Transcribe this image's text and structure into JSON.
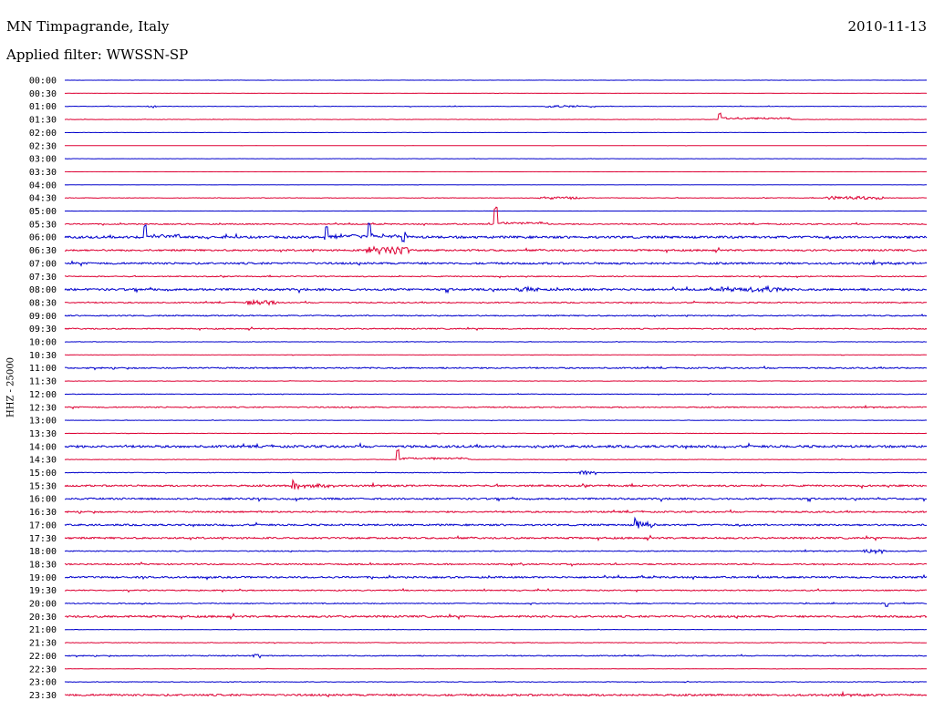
{
  "header": {
    "station": "MN Timpagrande, Italy",
    "date": "2010-11-13",
    "filter": "Applied filter: WWSSN-SP"
  },
  "axis": {
    "ylabel": "HHZ - 25000"
  },
  "colors": {
    "even_row": "#0000cc",
    "odd_row": "#dd0033"
  },
  "chart_data": {
    "type": "line",
    "title": "MN Timpagrande, Italy",
    "subtitle": "Applied filter: WWSSN-SP",
    "ylabel": "HHZ - 25000",
    "xlabel": "",
    "grid": false,
    "x_unit": "minutes past row start",
    "x_range": [
      0,
      30
    ],
    "row_labels": [
      "00:00",
      "00:30",
      "01:00",
      "01:30",
      "02:00",
      "02:30",
      "03:00",
      "03:30",
      "04:00",
      "04:30",
      "05:00",
      "05:30",
      "06:00",
      "06:30",
      "07:00",
      "07:30",
      "08:00",
      "08:30",
      "09:00",
      "09:30",
      "10:00",
      "10:30",
      "11:00",
      "11:30",
      "12:00",
      "12:30",
      "13:00",
      "13:30",
      "14:00",
      "14:30",
      "15:00",
      "15:30",
      "16:00",
      "16:30",
      "17:00",
      "17:30",
      "18:00",
      "18:30",
      "19:00",
      "19:30",
      "20:00",
      "20:30",
      "21:00",
      "21:30",
      "22:00",
      "22:30",
      "23:00",
      "23:30"
    ],
    "row_noise": [
      0.1,
      0.1,
      0.25,
      0.2,
      0.1,
      0.1,
      0.15,
      0.1,
      0.1,
      0.3,
      0.1,
      0.6,
      1.2,
      0.9,
      1.0,
      0.5,
      1.1,
      0.6,
      0.6,
      0.6,
      0.2,
      0.2,
      0.7,
      0.2,
      0.3,
      0.6,
      0.2,
      0.2,
      1.2,
      0.3,
      0.3,
      0.9,
      0.9,
      0.8,
      0.9,
      0.9,
      0.5,
      0.7,
      0.9,
      0.6,
      0.5,
      1.0,
      0.2,
      0.3,
      0.5,
      0.2,
      0.3,
      1.0
    ],
    "events": [
      {
        "row": "01:00",
        "minute": 2.8,
        "amplitude": 1.5,
        "duration": 0.4,
        "kind": "burst"
      },
      {
        "row": "01:00",
        "minute": 16.7,
        "amplitude": 1.0,
        "duration": 1.8,
        "kind": "burst"
      },
      {
        "row": "01:30",
        "minute": 22.8,
        "amplitude": 6,
        "duration": 2.5,
        "kind": "offset"
      },
      {
        "row": "04:30",
        "minute": 16.5,
        "amplitude": 1.2,
        "duration": 1.5,
        "kind": "burst"
      },
      {
        "row": "04:30",
        "minute": 26.5,
        "amplitude": 1.5,
        "duration": 2.0,
        "kind": "burst"
      },
      {
        "row": "05:30",
        "minute": 15.0,
        "amplitude": 17,
        "duration": 1.8,
        "kind": "offset"
      },
      {
        "row": "06:00",
        "minute": 2.8,
        "amplitude": 12,
        "duration": 1.2,
        "kind": "offset"
      },
      {
        "row": "06:00",
        "minute": 9.1,
        "amplitude": 10,
        "duration": 1.6,
        "kind": "offset"
      },
      {
        "row": "06:00",
        "minute": 10.6,
        "amplitude": 13,
        "duration": 1.4,
        "kind": "offset"
      },
      {
        "row": "06:00",
        "minute": 11.8,
        "amplitude": 5,
        "duration": 0.3,
        "kind": "spike"
      },
      {
        "row": "06:30",
        "minute": 10.5,
        "amplitude": 4,
        "duration": 1.5,
        "kind": "burst"
      },
      {
        "row": "08:00",
        "minute": 15.8,
        "amplitude": 2,
        "duration": 0.8,
        "kind": "burst"
      },
      {
        "row": "08:00",
        "minute": 22.8,
        "amplitude": 2.5,
        "duration": 2.4,
        "kind": "burst"
      },
      {
        "row": "08:30",
        "minute": 6.3,
        "amplitude": 2,
        "duration": 1.2,
        "kind": "burst"
      },
      {
        "row": "14:30",
        "minute": 11.6,
        "amplitude": 10,
        "duration": 2.5,
        "kind": "offset"
      },
      {
        "row": "15:00",
        "minute": 17.9,
        "amplitude": 2,
        "duration": 0.6,
        "kind": "burst"
      },
      {
        "row": "15:30",
        "minute": 7.9,
        "amplitude": 8,
        "duration": 1.5,
        "kind": "quake"
      },
      {
        "row": "17:00",
        "minute": 19.8,
        "amplitude": 10,
        "duration": 0.9,
        "kind": "quake"
      },
      {
        "row": "18:00",
        "minute": 27.8,
        "amplitude": 2,
        "duration": 0.8,
        "kind": "burst"
      },
      {
        "row": "20:00",
        "minute": 28.6,
        "amplitude": 3,
        "duration": 0.5,
        "kind": "spike"
      },
      {
        "row": "22:00",
        "minute": 6.5,
        "amplitude": 2,
        "duration": 0.3,
        "kind": "burst"
      }
    ]
  }
}
